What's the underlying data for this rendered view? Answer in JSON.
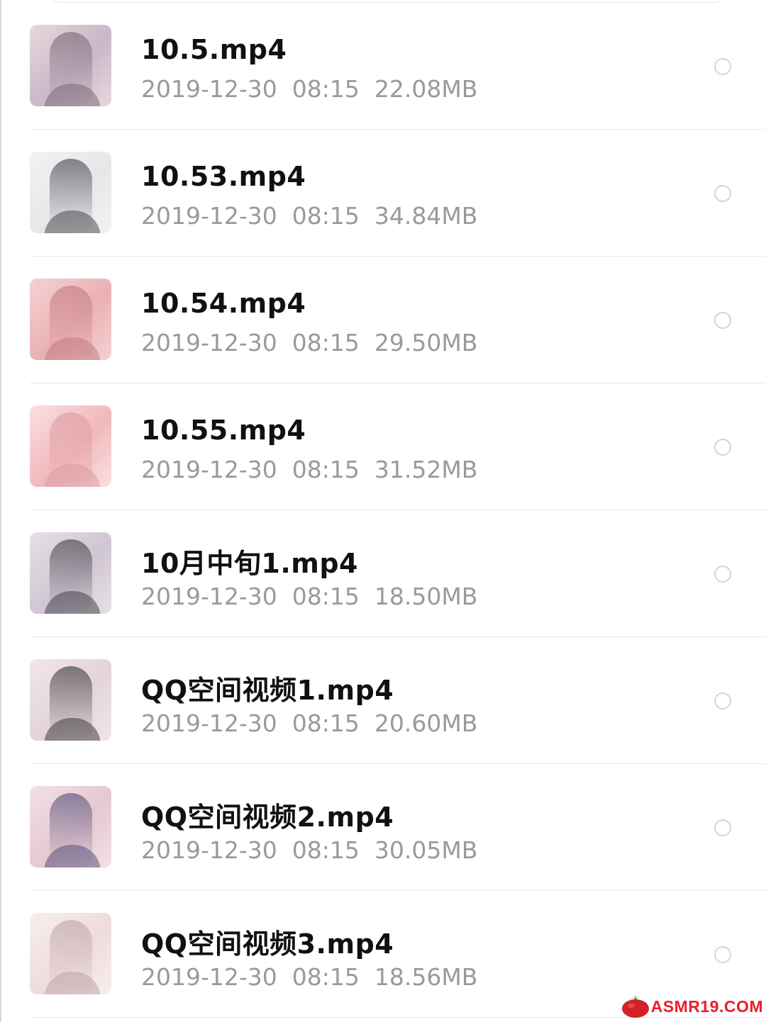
{
  "files": [
    {
      "name": "10.5.mp4",
      "date": "2019-12-30",
      "time": "08:15",
      "size": "22.08MB",
      "thumb_colors": [
        "#c8b8c8",
        "#6b5a66",
        "#e8d8dc"
      ]
    },
    {
      "name": "10.53.mp4",
      "date": "2019-12-30",
      "time": "08:15",
      "size": "34.84MB",
      "thumb_colors": [
        "#e9e6ea",
        "#2a2a2e",
        "#f3f1f3"
      ]
    },
    {
      "name": "10.54.mp4",
      "date": "2019-12-30",
      "time": "08:15",
      "size": "29.50MB",
      "thumb_colors": [
        "#eab0b4",
        "#b87078",
        "#f4d2d2"
      ]
    },
    {
      "name": "10.55.mp4",
      "date": "2019-12-30",
      "time": "08:15",
      "size": "31.52MB",
      "thumb_colors": [
        "#f0b8bc",
        "#d8949c",
        "#fbe0e0"
      ]
    },
    {
      "name": "10月中旬1.mp4",
      "date": "2019-12-30",
      "time": "08:15",
      "size": "18.50MB",
      "thumb_colors": [
        "#cfc6d2",
        "#2c2830",
        "#e8dfe6"
      ]
    },
    {
      "name": "QQ空间视频1.mp4",
      "date": "2019-12-30",
      "time": "08:15",
      "size": "20.60MB",
      "thumb_colors": [
        "#e2d4d8",
        "#1e1c22",
        "#f2e6e8"
      ]
    },
    {
      "name": "QQ空间视频2.mp4",
      "date": "2019-12-30",
      "time": "08:15",
      "size": "30.05MB",
      "thumb_colors": [
        "#e6c8d0",
        "#3c3a6a",
        "#f2e0e6"
      ]
    },
    {
      "name": "QQ空间视频3.mp4",
      "date": "2019-12-30",
      "time": "08:15",
      "size": "18.56MB",
      "thumb_colors": [
        "#eedcdc",
        "#b49aa2",
        "#f8eeee"
      ]
    }
  ],
  "watermark": {
    "text": "ASMR19.COM",
    "icon": "tomato-icon",
    "color": "#e8202a"
  }
}
